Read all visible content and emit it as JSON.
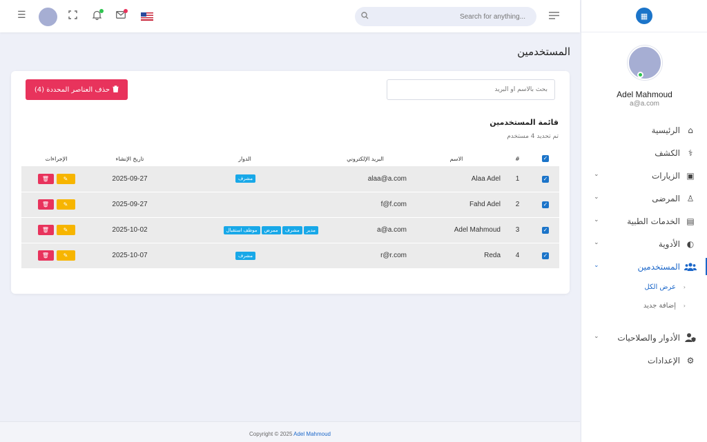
{
  "header": {
    "search_placeholder": "Search for anything...",
    "flag": "us-flag-icon"
  },
  "sidebar": {
    "user_name": "Adel Mahmoud",
    "user_email": "a@a.com",
    "items": [
      {
        "label": "الرئيسية",
        "icon": "home-icon"
      },
      {
        "label": "الكشف",
        "icon": "stethoscope-icon"
      },
      {
        "label": "الزيارات",
        "icon": "calendar-check-icon"
      },
      {
        "label": "المرضى",
        "icon": "patient-icon"
      },
      {
        "label": "الخدمات الطبية",
        "icon": "clipboard-medical-icon"
      },
      {
        "label": "الأدوية",
        "icon": "pills-icon"
      },
      {
        "label": "المستخدمين",
        "icon": "users-icon"
      },
      {
        "label": "الأدوار والصلاحيات",
        "icon": "user-shield-icon"
      },
      {
        "label": "الإعدادات",
        "icon": "gear-icon"
      }
    ],
    "sub_items": [
      {
        "label": "عرض الكل"
      },
      {
        "label": "إضافة جديد"
      }
    ]
  },
  "page": {
    "title": "المستخدمين",
    "delete_button": "حذف العناصر المحددة (4)",
    "filter_placeholder": "بحث بالاسم أو البريد",
    "list_title": "قائمة المستخدمين",
    "list_subtitle": "تم تحديد 4 مستخدم"
  },
  "table": {
    "headers": {
      "number": "#",
      "name": "الاسم",
      "email": "البريد الإلكتروني",
      "roles": "الدوار",
      "created": "تاريخ الإنشاء",
      "actions": "الإجراءات"
    },
    "rows": [
      {
        "number": "1",
        "name": "Alaa Adel",
        "email": "alaa@a.com",
        "roles": [
          "مشرف"
        ],
        "created": "2025-09-27"
      },
      {
        "number": "2",
        "name": "Fahd Adel",
        "email": "f@f.com",
        "roles": [],
        "created": "2025-09-27"
      },
      {
        "number": "3",
        "name": "Adel Mahmoud",
        "email": "a@a.com",
        "roles": [
          "مدير",
          "مشرف",
          "ممرض",
          "موظف استقبال"
        ],
        "created": "2025-10-02"
      },
      {
        "number": "4",
        "name": "Reda",
        "email": "r@r.com",
        "roles": [
          "مشرف"
        ],
        "created": "2025-10-07"
      }
    ]
  },
  "footer": {
    "copyright": "Copyright © 2025",
    "author": "Adel Mahmoud"
  },
  "colors": {
    "primary": "#1a66c9",
    "danger": "#e8335c",
    "warning": "#f7b500",
    "badge": "#18a8e8"
  }
}
